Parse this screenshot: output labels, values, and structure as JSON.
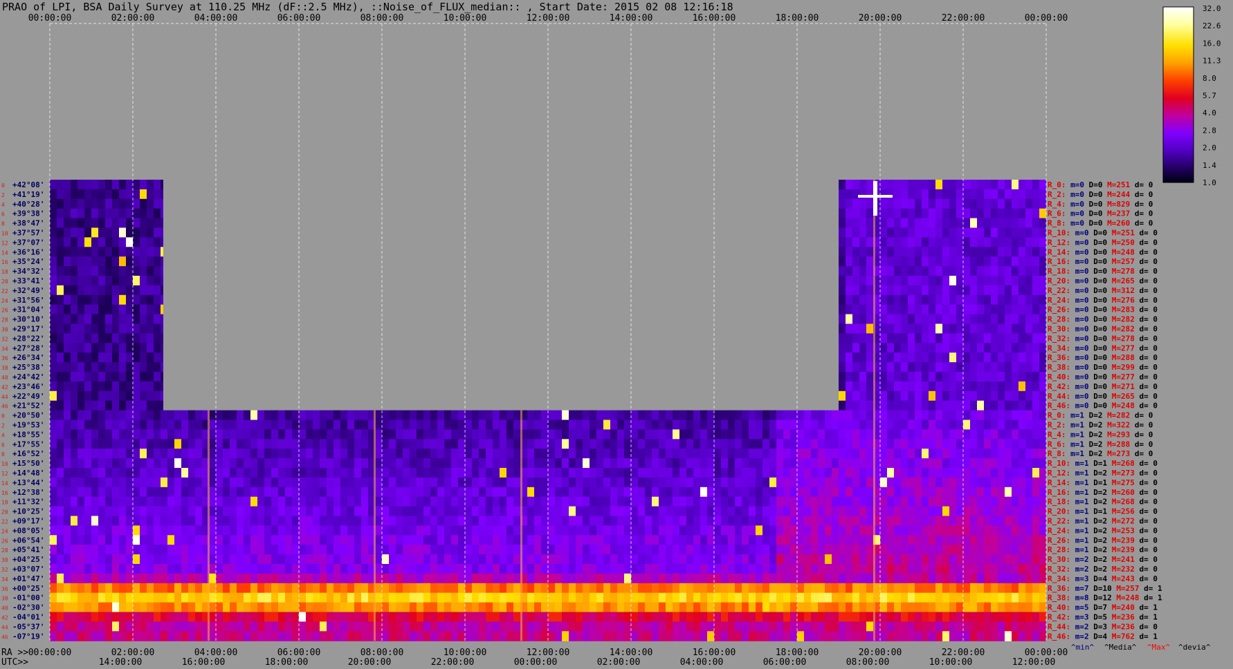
{
  "title": "PRAO of LPI, BSA Daily Survey at 110.25 MHz (dF::2.5 MHz), ::Noise_of_FLUX_median:: , Start Date: 2015 02 08 12:16:18",
  "chart_data": {
    "type": "heatmap",
    "title": "PRAO of LPI, BSA Daily Survey at 110.25 MHz (dF::2.5 MHz), ::Noise_of_FLUX_median:: , Start Date: 2015 02 08 12:16:18",
    "x_top_ticks": [
      "00:00:00",
      "02:00:00",
      "04:00:00",
      "06:00:00",
      "08:00:00",
      "10:00:00",
      "12:00:00",
      "14:00:00",
      "16:00:00",
      "18:00:00",
      "20:00:00",
      "22:00:00",
      "00:00:00"
    ],
    "x_bottom_ra_ticks": [
      "00:00:00",
      "02:00:00",
      "04:00:00",
      "06:00:00",
      "08:00:00",
      "10:00:00",
      "12:00:00",
      "14:00:00",
      "16:00:00",
      "18:00:00",
      "20:00:00",
      "22:00:00",
      "00:00:00"
    ],
    "x_bottom_utc_ticks": [
      "14:00:00",
      "16:00:00",
      "18:00:00",
      "20:00:00",
      "22:00:00",
      "00:00:00",
      "02:00:00",
      "04:00:00",
      "06:00:00",
      "08:00:00",
      "10:00:00",
      "12:00:00"
    ],
    "ra_axis_label": "RA >>",
    "utc_axis_label": "UTC>>",
    "declinations": [
      "+42°08'",
      "+41°19'",
      "+40°28'",
      "+39°38'",
      "+38°47'",
      "+37°57'",
      "+37°07'",
      "+36°16'",
      "+35°24'",
      "+34°32'",
      "+33°41'",
      "+32°49'",
      "+31°56'",
      "+31°04'",
      "+30°10'",
      "+29°17'",
      "+28°22'",
      "+27°28'",
      "+26°34'",
      "+25°38'",
      "+24°42'",
      "+23°46'",
      "+22°49'",
      "+21°52'",
      "+20°50'",
      "+19°53'",
      "+18°55'",
      "+17°55'",
      "+16°52'",
      "+15°50'",
      "+14°48'",
      "+13°44'",
      "+12°38'",
      "+11°32'",
      "+10°25'",
      "+09°17'",
      "+08°05'",
      "+06°54'",
      "+05°41'",
      "+04°25'",
      "+03°07'",
      "+01°47'",
      "+00°25'",
      "-01°00'",
      "-02°30'",
      "-04°01'",
      "-05°37'",
      "-07°19'"
    ],
    "row_numbers": [
      "0",
      "2",
      "4",
      "6",
      "8",
      "10",
      "12",
      "14",
      "16",
      "18",
      "20",
      "22",
      "24",
      "26",
      "28",
      "30",
      "32",
      "34",
      "36",
      "38",
      "40",
      "42",
      "44",
      "46",
      "0",
      "2",
      "4",
      "6",
      "8",
      "10",
      "12",
      "14",
      "16",
      "18",
      "20",
      "22",
      "24",
      "26",
      "28",
      "30",
      "32",
      "34",
      "36",
      "38",
      "40",
      "42",
      "44",
      "46"
    ],
    "colorbar": {
      "ticks": [
        "32.0",
        "22.6",
        "16.0",
        "11.3",
        "8.0",
        "5.7",
        "4.0",
        "2.8",
        "2.0",
        "1.4",
        "1.0"
      ],
      "scale": "log",
      "range": [
        1.0,
        32.0
      ]
    },
    "row_stats": [
      {
        "r": "R_0:",
        "m": "m=0",
        "D": "D=0",
        "M": "M=251",
        "d": "d= 0"
      },
      {
        "r": "R_2:",
        "m": "m=0",
        "D": "D=0",
        "M": "M=244",
        "d": "d= 0"
      },
      {
        "r": "R_4:",
        "m": "m=0",
        "D": "D=0",
        "M": "M=829",
        "d": "d= 0"
      },
      {
        "r": "R_6:",
        "m": "m=0",
        "D": "D=0",
        "M": "M=237",
        "d": "d= 0"
      },
      {
        "r": "R_8:",
        "m": "m=0",
        "D": "D=0",
        "M": "M=260",
        "d": "d= 0"
      },
      {
        "r": "R_10:",
        "m": "m=0",
        "D": "D=0",
        "M": "M=251",
        "d": "d= 0"
      },
      {
        "r": "R_12:",
        "m": "m=0",
        "D": "D=0",
        "M": "M=250",
        "d": "d= 0"
      },
      {
        "r": "R_14:",
        "m": "m=0",
        "D": "D=0",
        "M": "M=248",
        "d": "d= 0"
      },
      {
        "r": "R_16:",
        "m": "m=0",
        "D": "D=0",
        "M": "M=257",
        "d": "d= 0"
      },
      {
        "r": "R_18:",
        "m": "m=0",
        "D": "D=0",
        "M": "M=278",
        "d": "d= 0"
      },
      {
        "r": "R_20:",
        "m": "m=0",
        "D": "D=0",
        "M": "M=265",
        "d": "d= 0"
      },
      {
        "r": "R_22:",
        "m": "m=0",
        "D": "D=0",
        "M": "M=312",
        "d": "d= 0"
      },
      {
        "r": "R_24:",
        "m": "m=0",
        "D": "D=0",
        "M": "M=276",
        "d": "d= 0"
      },
      {
        "r": "R_26:",
        "m": "m=0",
        "D": "D=0",
        "M": "M=283",
        "d": "d= 0"
      },
      {
        "r": "R_28:",
        "m": "m=0",
        "D": "D=0",
        "M": "M=282",
        "d": "d= 0"
      },
      {
        "r": "R_30:",
        "m": "m=0",
        "D": "D=0",
        "M": "M=282",
        "d": "d= 0"
      },
      {
        "r": "R_32:",
        "m": "m=0",
        "D": "D=0",
        "M": "M=278",
        "d": "d= 0"
      },
      {
        "r": "R_34:",
        "m": "m=0",
        "D": "D=0",
        "M": "M=277",
        "d": "d= 0"
      },
      {
        "r": "R_36:",
        "m": "m=0",
        "D": "D=0",
        "M": "M=288",
        "d": "d= 0"
      },
      {
        "r": "R_38:",
        "m": "m=0",
        "D": "D=0",
        "M": "M=299",
        "d": "d= 0"
      },
      {
        "r": "R_40:",
        "m": "m=0",
        "D": "D=0",
        "M": "M=277",
        "d": "d= 0"
      },
      {
        "r": "R_42:",
        "m": "m=0",
        "D": "D=0",
        "M": "M=271",
        "d": "d= 0"
      },
      {
        "r": "R_44:",
        "m": "m=0",
        "D": "D=0",
        "M": "M=265",
        "d": "d= 0"
      },
      {
        "r": "R_46:",
        "m": "m=0",
        "D": "D=0",
        "M": "M=248",
        "d": "d= 0"
      },
      {
        "r": "R_0:",
        "m": "m=1",
        "D": "D=2",
        "M": "M=282",
        "d": "d= 0"
      },
      {
        "r": "R_2:",
        "m": "m=1",
        "D": "D=2",
        "M": "M=322",
        "d": "d= 0"
      },
      {
        "r": "R_4:",
        "m": "m=1",
        "D": "D=2",
        "M": "M=293",
        "d": "d= 0"
      },
      {
        "r": "R_6:",
        "m": "m=1",
        "D": "D=2",
        "M": "M=288",
        "d": "d= 0"
      },
      {
        "r": "R_8:",
        "m": "m=1",
        "D": "D=2",
        "M": "M=273",
        "d": "d= 0"
      },
      {
        "r": "R_10:",
        "m": "m=1",
        "D": "D=1",
        "M": "M=268",
        "d": "d= 0"
      },
      {
        "r": "R_12:",
        "m": "m=1",
        "D": "D=2",
        "M": "M=273",
        "d": "d= 0"
      },
      {
        "r": "R_14:",
        "m": "m=1",
        "D": "D=1",
        "M": "M=275",
        "d": "d= 0"
      },
      {
        "r": "R_16:",
        "m": "m=1",
        "D": "D=2",
        "M": "M=260",
        "d": "d= 0"
      },
      {
        "r": "R_18:",
        "m": "m=1",
        "D": "D=2",
        "M": "M=268",
        "d": "d= 0"
      },
      {
        "r": "R_20:",
        "m": "m=1",
        "D": "D=1",
        "M": "M=256",
        "d": "d= 0"
      },
      {
        "r": "R_22:",
        "m": "m=1",
        "D": "D=2",
        "M": "M=272",
        "d": "d= 0"
      },
      {
        "r": "R_24:",
        "m": "m=1",
        "D": "D=2",
        "M": "M=253",
        "d": "d= 0"
      },
      {
        "r": "R_26:",
        "m": "m=1",
        "D": "D=2",
        "M": "M=239",
        "d": "d= 0"
      },
      {
        "r": "R_28:",
        "m": "m=1",
        "D": "D=2",
        "M": "M=239",
        "d": "d= 0"
      },
      {
        "r": "R_30:",
        "m": "m=2",
        "D": "D=2",
        "M": "M=241",
        "d": "d= 0"
      },
      {
        "r": "R_32:",
        "m": "m=2",
        "D": "D=2",
        "M": "M=232",
        "d": "d= 0"
      },
      {
        "r": "R_34:",
        "m": "m=3",
        "D": "D=4",
        "M": "M=243",
        "d": "d= 0"
      },
      {
        "r": "R_36:",
        "m": "m=7",
        "D": "D=10",
        "M": "M=257",
        "d": "d= 1"
      },
      {
        "r": "R_38:",
        "m": "m=8",
        "D": "D=12",
        "M": "M=248",
        "d": "d= 1"
      },
      {
        "r": "R_40:",
        "m": "m=5",
        "D": "D=7",
        "M": "M=240",
        "d": "d= 1"
      },
      {
        "r": "R_42:",
        "m": "m=3",
        "D": "D=5",
        "M": "M=236",
        "d": "d= 1"
      },
      {
        "r": "R_44:",
        "m": "m=2",
        "D": "D=3",
        "M": "M=236",
        "d": "d= 0"
      },
      {
        "r": "R_46:",
        "m": "m=2",
        "D": "D=4",
        "M": "M=762",
        "d": "d= 1"
      }
    ],
    "legend_keys": [
      "^min^",
      "^Media^",
      "^Max^",
      "^devia^"
    ],
    "colors": {
      "background": "#999999",
      "row_label": "#000060",
      "row_number": "#d02020",
      "stat_red": "#e00000",
      "stat_navy": "#000080",
      "stat_black": "#000000",
      "legend_min": "#000080",
      "legend_media": "#000000",
      "legend_max": "#ff0000",
      "legend_devia": "#000000"
    }
  }
}
